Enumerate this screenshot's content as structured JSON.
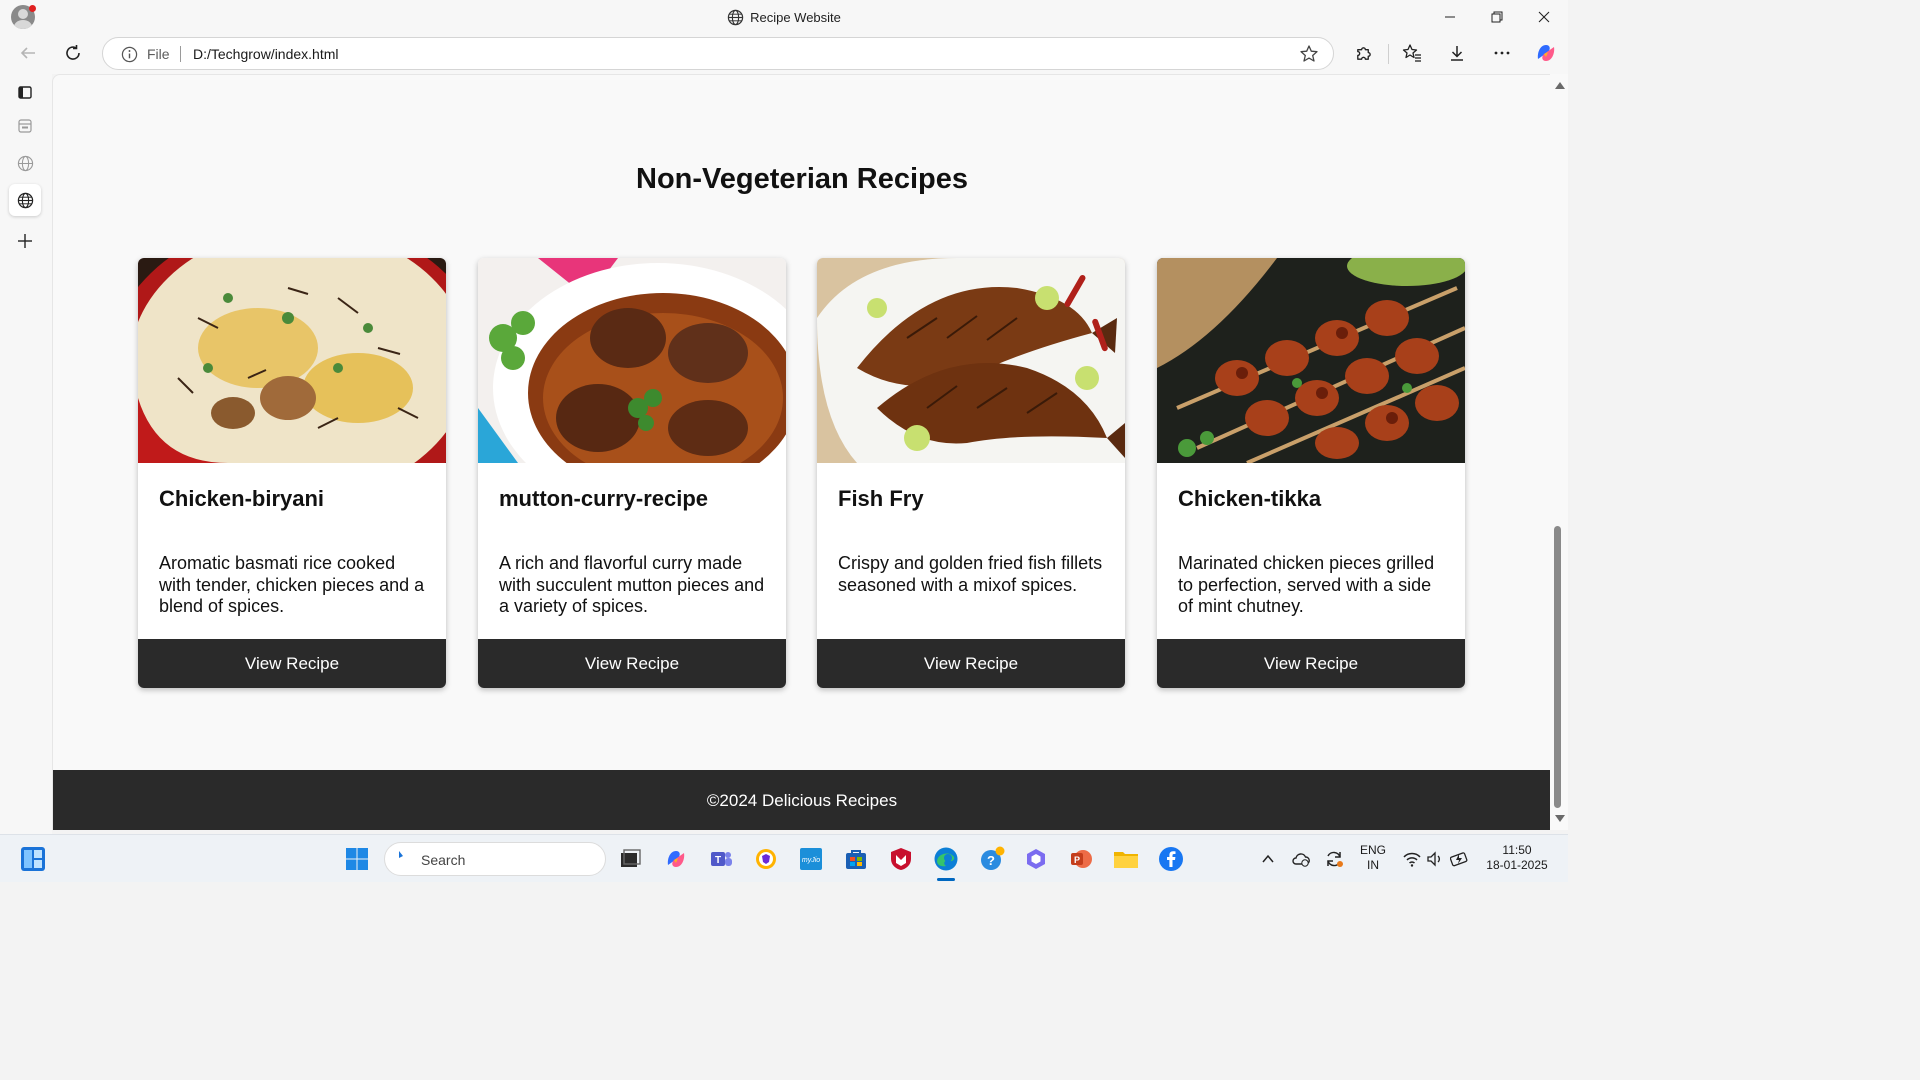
{
  "window": {
    "title": "Recipe Website"
  },
  "toolbar": {
    "file_label": "File",
    "url": "D:/Techgrow/index.html"
  },
  "page": {
    "heading": "Non-Vegeterian Recipes",
    "cards": [
      {
        "title": "Chicken-biryani",
        "description": "Aromatic basmati rice cooked with tender, chicken pieces and a blend of spices.",
        "button": "View Recipe",
        "image": "chicken-biryani-photo"
      },
      {
        "title": "mutton-curry-recipe",
        "description": "A rich and flavorful curry made with succulent mutton pieces and a variety of spices.",
        "button": "View Recipe",
        "image": "mutton-curry-photo"
      },
      {
        "title": "Fish Fry",
        "description": "Crispy and golden fried fish fillets seasoned with a mixof spices.",
        "button": "View Recipe",
        "image": "fish-fry-photo"
      },
      {
        "title": "Chicken-tikka",
        "description": "Marinated chicken pieces grilled to perfection, served with a side of mint chutney.",
        "button": "View Recipe",
        "image": "chicken-tikka-photo"
      }
    ],
    "footer": "©2024 Delicious Recipes"
  },
  "taskbar": {
    "search_placeholder": "Search",
    "language": "ENG",
    "region": "IN",
    "time": "11:50",
    "date": "18-01-2025"
  },
  "colors": {
    "card_button_bg": "#2a2a2a",
    "footer_bg": "#2a2a2a",
    "page_bg": "#f9f9f9",
    "accent": "#0067c0"
  }
}
